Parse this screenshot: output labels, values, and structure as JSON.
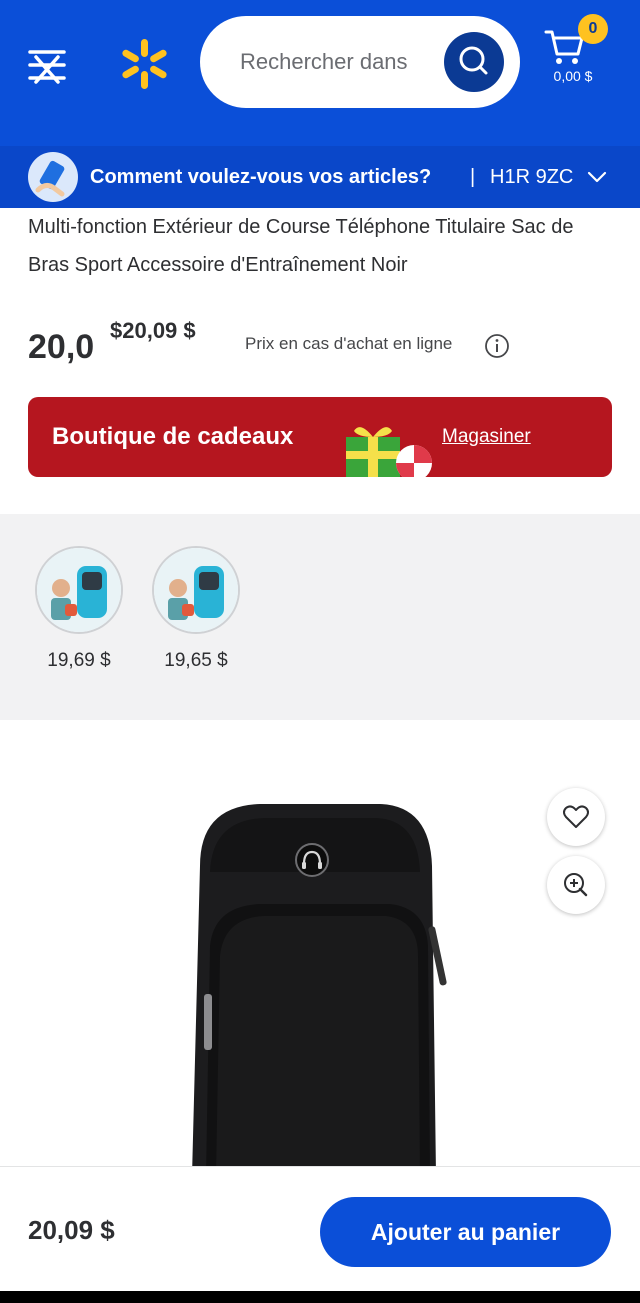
{
  "header": {
    "search_placeholder": "Rechercher dans",
    "cart_count": "0",
    "cart_total": "0,00 $",
    "colors": {
      "brand_blue": "#0b4fd8",
      "spark_yellow": "#ffc220"
    },
    "icons": {
      "menu": "menu-icon",
      "spark": "walmart-spark-icon",
      "search": "search-icon",
      "cart": "cart-icon"
    }
  },
  "delivery": {
    "question": "Comment voulez-vous vos articles?",
    "separator": "|",
    "postal_code": "H1R 9ZC",
    "icons": {
      "left": "phone-hand-icon",
      "right": "chevron-down-icon"
    }
  },
  "product": {
    "title": "Multi-fonction Extérieur de Course Téléphone Titulaire Sac de Bras Sport Accessoire d'Entraînement Noir",
    "price_main": "20,0",
    "price_sup": "$20,09 $",
    "price_note": "Prix en cas d'achat en ligne"
  },
  "gift_banner": {
    "title": "Boutique de cadeaux",
    "link": "Magasiner",
    "color": "#b5161f"
  },
  "variants": [
    {
      "price": "19,69 $"
    },
    {
      "price": "19,65 $"
    }
  ],
  "image_actions": {
    "favorite": "heart-icon",
    "zoom": "zoom-in-icon"
  },
  "bottom_bar": {
    "price": "20,09 $",
    "add_to_cart": "Ajouter au panier"
  }
}
